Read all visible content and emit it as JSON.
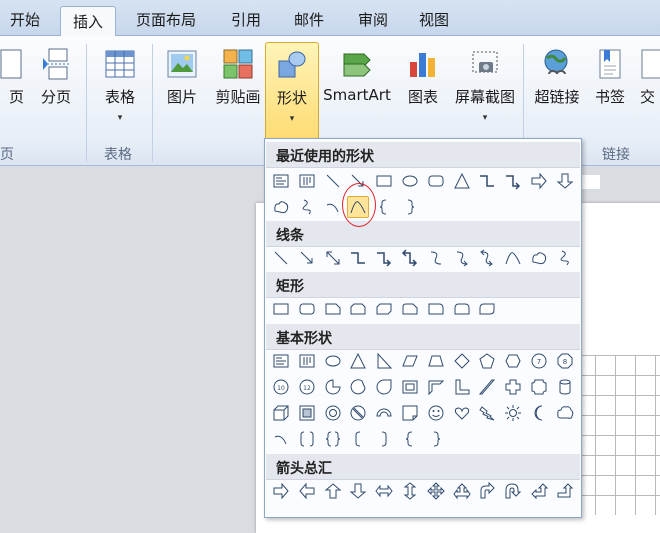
{
  "tabs": [
    "开始",
    "插入",
    "页面布局",
    "引用",
    "邮件",
    "审阅",
    "视图"
  ],
  "active_tab": "插入",
  "ribbon": {
    "partial_left_1": "页",
    "partial_left_group": "页",
    "btn_page_break": "分页",
    "btn_table": "表格",
    "btn_picture": "图片",
    "btn_clipart": "剪贴画",
    "btn_shapes": "形状",
    "btn_smartart": "SmartArt",
    "btn_chart": "图表",
    "btn_screenshot": "屏幕截图",
    "btn_hyperlink": "超链接",
    "btn_bookmark": "书签",
    "btn_partial_right": "交",
    "group_table": "表格",
    "group_links": "链接"
  },
  "gallery": {
    "sections": [
      "最近使用的形状",
      "线条",
      "矩形",
      "基本形状",
      "箭头总汇"
    ],
    "recent_shapes": [
      "text-box",
      "vertical-text-box",
      "line",
      "arrow-line",
      "rectangle",
      "oval",
      "rounded-rectangle",
      "triangle",
      "elbow-connector",
      "elbow-arrow-connector",
      "right-arrow",
      "down-arrow",
      "freeform",
      "scribble",
      "arc",
      "curve",
      "left-brace",
      "right-brace"
    ],
    "line_shapes": [
      "line",
      "arrow",
      "double-arrow",
      "elbow-connector",
      "elbow-arrow-connector",
      "elbow-double-arrow-connector",
      "curved-connector",
      "curved-arrow-connector",
      "curved-double-arrow-connector",
      "curve",
      "freeform",
      "scribble"
    ],
    "rect_shapes": [
      "rectangle",
      "rounded-rectangle",
      "snip-single-corner",
      "snip-same-side",
      "snip-diagonal",
      "snip-round",
      "round-single-corner",
      "round-same-side",
      "round-diagonal"
    ],
    "basic_shapes_rows": [
      [
        "text-box",
        "vertical-text-box",
        "oval",
        "triangle",
        "right-triangle",
        "parallelogram",
        "trapezoid",
        "diamond",
        "pentagon",
        "hexagon",
        "heptagon",
        "octagon"
      ],
      [
        "decagon",
        "dodecagon",
        "pie",
        "chord",
        "teardrop",
        "frame",
        "half-frame",
        "l-shape",
        "diagonal-stripe",
        "cross",
        "plaque",
        "can"
      ],
      [
        "cube",
        "bevel",
        "donut",
        "no-symbol",
        "block-arc",
        "folded-corner",
        "smiley",
        "heart",
        "lightning",
        "sun",
        "moon",
        "cloud"
      ],
      [
        "arc",
        "double-bracket",
        "double-brace",
        "left-bracket",
        "right-bracket",
        "left-brace",
        "right-brace"
      ]
    ],
    "arrow_shapes": [
      "right-arrow",
      "left-arrow",
      "up-arrow",
      "down-arrow",
      "left-right-arrow",
      "up-down-arrow",
      "quad-arrow",
      "left-right-up-arrow",
      "bent-arrow",
      "u-turn-arrow",
      "left-up-arrow",
      "bent-up-arrow"
    ]
  }
}
